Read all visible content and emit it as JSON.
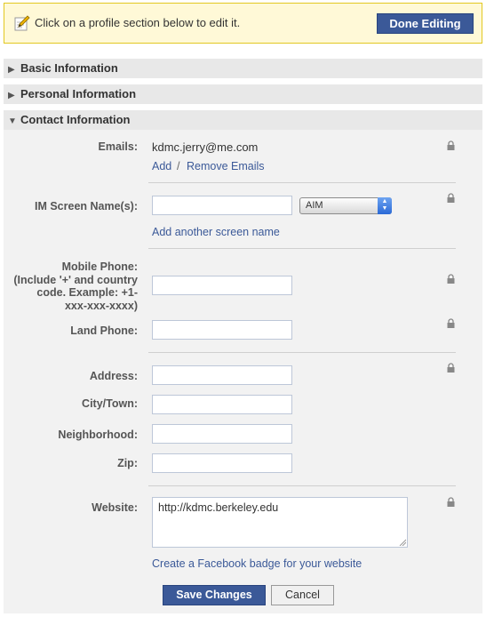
{
  "notice": {
    "text": "Click on a profile section below to edit it.",
    "done_label": "Done Editing"
  },
  "sections": {
    "basic": "Basic Information",
    "personal": "Personal Information",
    "contact": "Contact Information"
  },
  "contact": {
    "emails_label": "Emails:",
    "email_value": "kdmc.jerry@me.com",
    "add_link": "Add",
    "link_separator": "/",
    "remove_link": "Remove Emails",
    "im_label": "IM Screen Name(s):",
    "im_value": "",
    "im_service": "AIM",
    "add_screen_name": "Add another screen name",
    "mobile_label_lines": [
      "Mobile Phone:",
      "(Include '+' and country",
      "code. Example: +1-",
      "xxx-xxx-xxxx)"
    ],
    "mobile_value": "",
    "land_label": "Land Phone:",
    "land_value": "",
    "address_label": "Address:",
    "address_value": "",
    "city_label": "City/Town:",
    "city_value": "",
    "neighborhood_label": "Neighborhood:",
    "neighborhood_value": "",
    "zip_label": "Zip:",
    "zip_value": "",
    "website_label": "Website:",
    "website_value": "http://kdmc.berkeley.edu",
    "badge_link": "Create a Facebook badge for your website"
  },
  "actions": {
    "save_label": "Save Changes",
    "cancel_label": "Cancel"
  },
  "icons": {
    "pencil": "pencil-icon",
    "lock": "lock-icon",
    "collapsed": "triangle-right-icon",
    "expanded": "triangle-down-icon"
  },
  "colors": {
    "brand": "#3b5998",
    "notice_bg": "#fff9d7",
    "notice_border": "#e2c822",
    "section_bg": "#e8e8e8",
    "panel_bg": "#f2f2f2"
  }
}
